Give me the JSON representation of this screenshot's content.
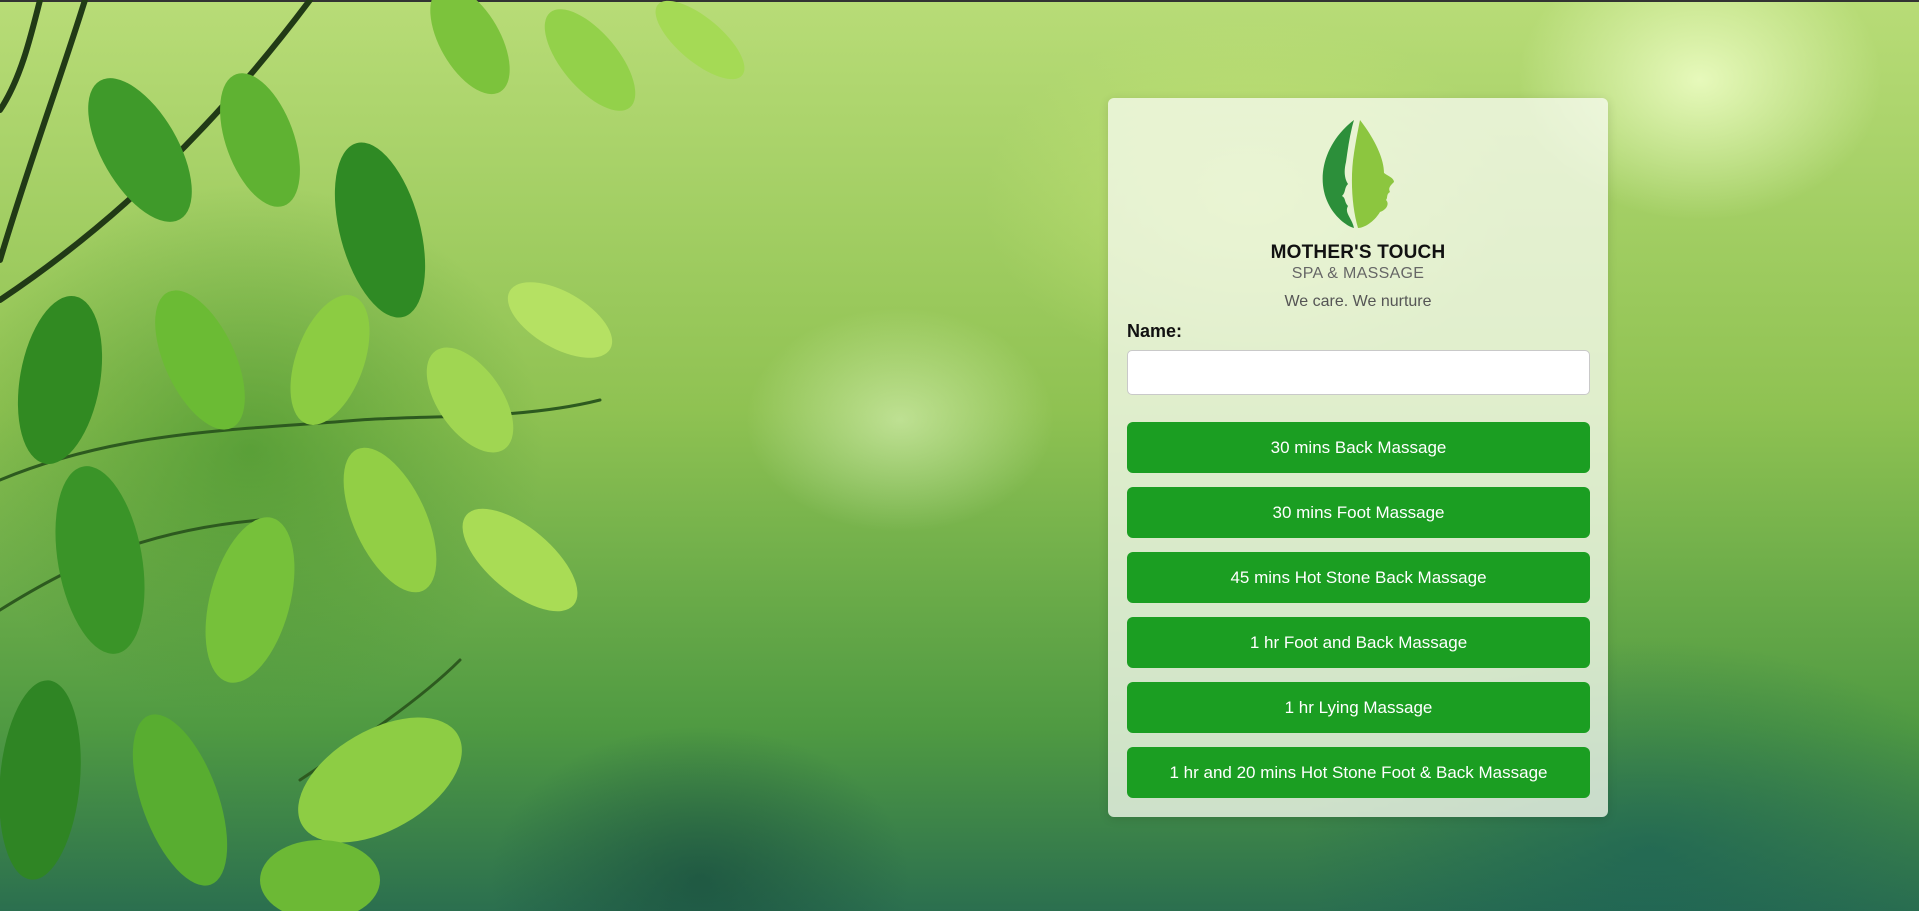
{
  "brand": {
    "name": "MOTHER'S TOUCH",
    "subtitle": "SPA & MASSAGE",
    "tagline": "We care. We nurture"
  },
  "form": {
    "name_label": "Name:",
    "name_value": "",
    "name_placeholder": ""
  },
  "services": [
    {
      "label": "30 mins Back Massage"
    },
    {
      "label": "30 mins Foot Massage"
    },
    {
      "label": "45 mins Hot Stone Back Massage"
    },
    {
      "label": "1 hr Foot and Back Massage"
    },
    {
      "label": "1 hr Lying Massage"
    },
    {
      "label": "1 hr and 20 mins Hot Stone Foot & Back Massage"
    }
  ],
  "colors": {
    "button": "#1b9e22",
    "logo_dark": "#2c8f3a",
    "logo_light": "#8cc63f"
  },
  "icons": {
    "logo": "leaf-faces-logo-icon"
  }
}
